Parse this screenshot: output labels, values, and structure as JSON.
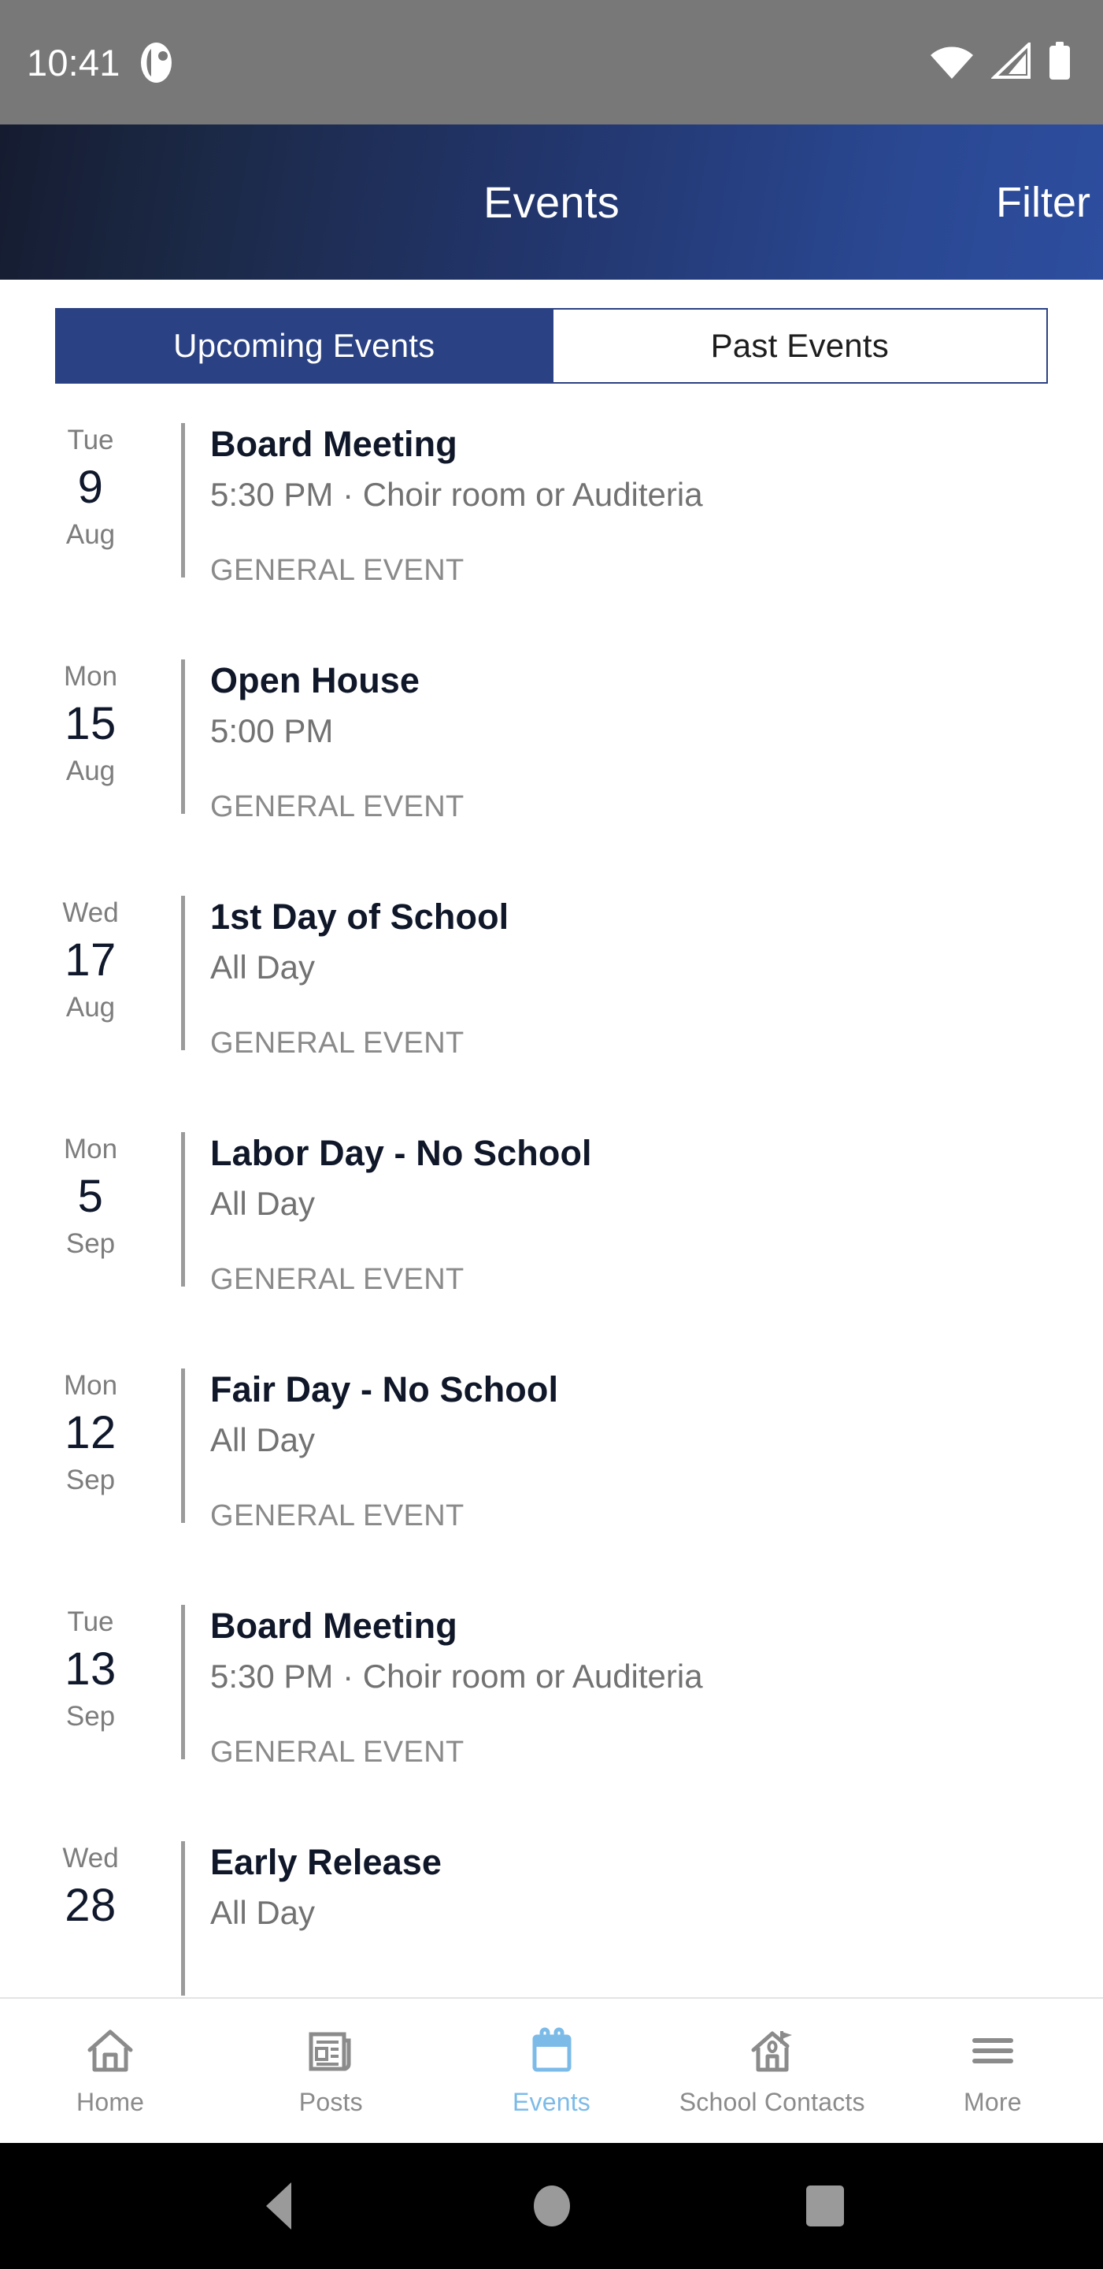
{
  "status_bar": {
    "time": "10:41",
    "app_badge_icon": "app-notification-icon",
    "wifi_icon": "wifi-icon",
    "cellular_icon": "cellular-signal-icon",
    "battery_icon": "battery-full-icon"
  },
  "header": {
    "title": "Events",
    "filter_label": "Filter",
    "gradient_start": "#151c30",
    "gradient_end": "#2d4d9e"
  },
  "tabs": {
    "accent_color": "#2a4183",
    "items": [
      {
        "label": "Upcoming Events",
        "active": true
      },
      {
        "label": "Past Events",
        "active": false
      }
    ]
  },
  "events": [
    {
      "dow": "Tue",
      "day": "9",
      "month": "Aug",
      "title": "Board Meeting",
      "meta": "5:30 PM · Choir room or Auditeria",
      "category": "GENERAL EVENT"
    },
    {
      "dow": "Mon",
      "day": "15",
      "month": "Aug",
      "title": "Open House",
      "meta": "5:00 PM",
      "category": "GENERAL EVENT"
    },
    {
      "dow": "Wed",
      "day": "17",
      "month": "Aug",
      "title": "1st Day of School",
      "meta": "All Day",
      "category": "GENERAL EVENT"
    },
    {
      "dow": "Mon",
      "day": "5",
      "month": "Sep",
      "title": "Labor Day - No School",
      "meta": "All Day",
      "category": "GENERAL EVENT"
    },
    {
      "dow": "Mon",
      "day": "12",
      "month": "Sep",
      "title": "Fair Day - No School",
      "meta": "All Day",
      "category": "GENERAL EVENT"
    },
    {
      "dow": "Tue",
      "day": "13",
      "month": "Sep",
      "title": "Board Meeting",
      "meta": "5:30 PM · Choir room or Auditeria",
      "category": "GENERAL EVENT"
    },
    {
      "dow": "Wed",
      "day": "28",
      "month": "",
      "title": "Early Release",
      "meta": "All Day",
      "category": ""
    }
  ],
  "bottom_nav": {
    "active_color": "#7cbbe8",
    "inactive_color": "#8b8b8b",
    "items": [
      {
        "label": "Home",
        "icon": "home-icon",
        "active": false
      },
      {
        "label": "Posts",
        "icon": "newspaper-icon",
        "active": false
      },
      {
        "label": "Events",
        "icon": "calendar-icon",
        "active": true
      },
      {
        "label": "School Contacts",
        "icon": "school-building-icon",
        "active": false
      },
      {
        "label": "More",
        "icon": "hamburger-menu-icon",
        "active": false
      }
    ]
  },
  "system_nav": {
    "back": "back-triangle-icon",
    "home": "home-circle-icon",
    "recents": "recents-square-icon"
  }
}
